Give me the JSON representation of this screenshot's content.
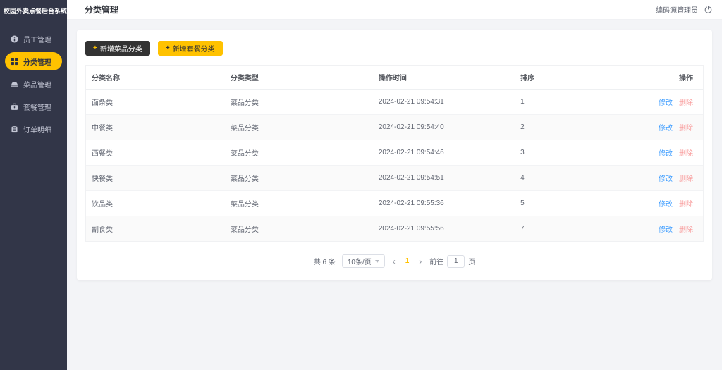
{
  "brand": "校园外卖点餐后台系统",
  "header": {
    "title": "分类管理",
    "user_name": "编码源管理员"
  },
  "sidebar": {
    "items": [
      {
        "label": "员工管理",
        "icon": "staff-icon"
      },
      {
        "label": "分类管理",
        "icon": "category-icon",
        "active": true
      },
      {
        "label": "菜品管理",
        "icon": "dish-icon"
      },
      {
        "label": "套餐管理",
        "icon": "meal-icon"
      },
      {
        "label": "订单明细",
        "icon": "order-icon"
      }
    ]
  },
  "toolbar": {
    "plus": "+",
    "add_dish_label": "新增菜品分类",
    "add_meal_label": "新增套餐分类"
  },
  "table": {
    "columns": [
      "分类名称",
      "分类类型",
      "操作时间",
      "排序",
      "操作"
    ],
    "edit_label": "修改",
    "delete_label": "删除",
    "rows": [
      {
        "name": "面条类",
        "type": "菜品分类",
        "time": "2024-02-21 09:54:31",
        "sort": "1"
      },
      {
        "name": "中餐类",
        "type": "菜品分类",
        "time": "2024-02-21 09:54:40",
        "sort": "2"
      },
      {
        "name": "西餐类",
        "type": "菜品分类",
        "time": "2024-02-21 09:54:46",
        "sort": "3"
      },
      {
        "name": "快餐类",
        "type": "菜品分类",
        "time": "2024-02-21 09:54:51",
        "sort": "4"
      },
      {
        "name": "饮品类",
        "type": "菜品分类",
        "time": "2024-02-21 09:55:36",
        "sort": "5"
      },
      {
        "name": "副食类",
        "type": "菜品分类",
        "time": "2024-02-21 09:55:56",
        "sort": "7"
      }
    ]
  },
  "pagination": {
    "total": "共 6 条",
    "page_size": "10条/页",
    "prev_icon": "‹",
    "current_page": "1",
    "next_icon": "›",
    "goto_label": "前往",
    "goto_value": "1",
    "page_unit": "页"
  },
  "colors": {
    "accent_yellow": "#ffc200",
    "sidebar_bg": "#323648",
    "dark_button": "#333333",
    "link_blue": "#409eff",
    "link_red": "#f89898"
  }
}
